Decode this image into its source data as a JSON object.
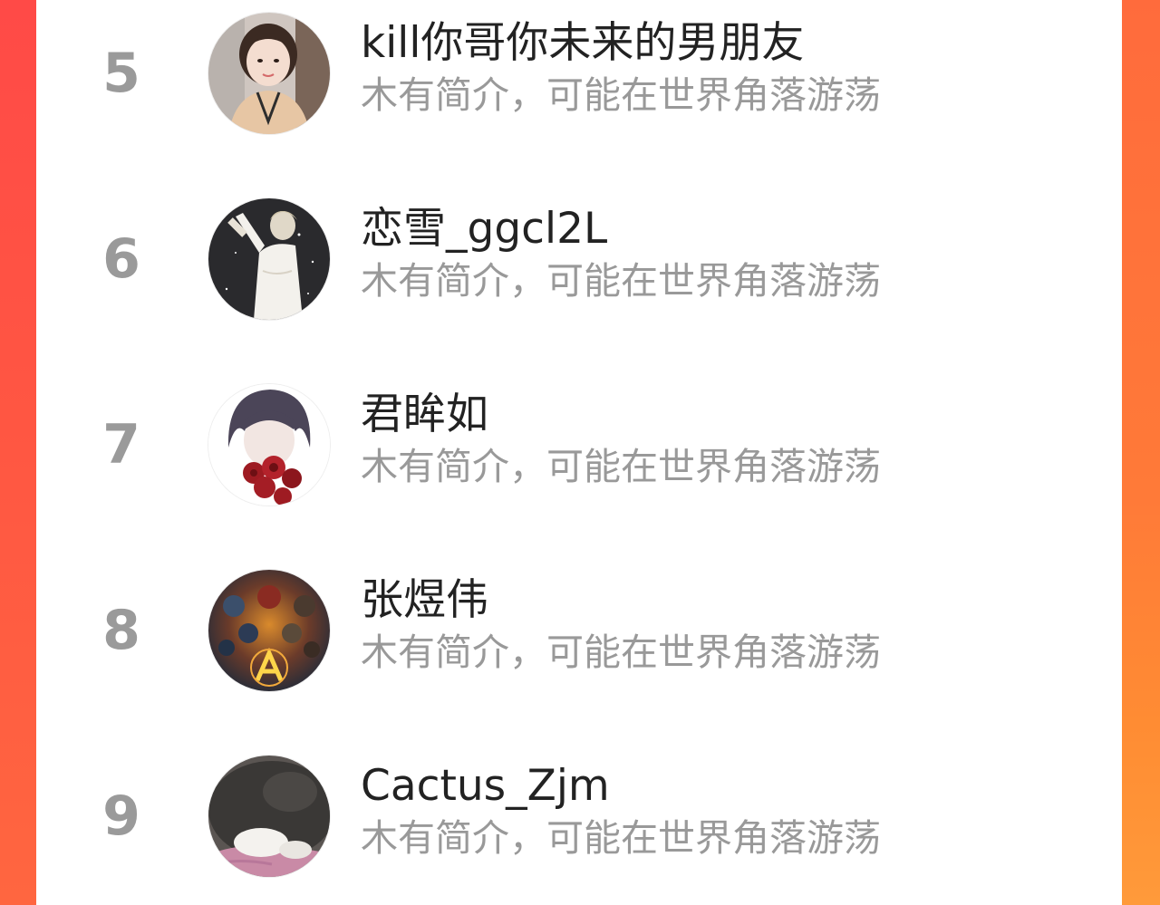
{
  "ranking": {
    "items": [
      {
        "rank": "5",
        "name": "kill你哥你未来的男朋友",
        "intro": "木有简介，可能在世界角落游荡",
        "avatar_icon": "girl-photo-avatar-icon"
      },
      {
        "rank": "6",
        "name": "恋雪_ggcl2L",
        "intro": "木有简介，可能在世界角落游荡",
        "avatar_icon": "anime-boy-avatar-icon"
      },
      {
        "rank": "7",
        "name": "君眸如",
        "intro": "木有简介，可能在世界角落游荡",
        "avatar_icon": "anime-boy-roses-avatar-icon"
      },
      {
        "rank": "8",
        "name": "张煜伟",
        "intro": "木有简介，可能在世界角落游荡",
        "avatar_icon": "avengers-poster-avatar-icon"
      },
      {
        "rank": "9",
        "name": "Cactus_Zjm",
        "intro": "木有简介，可能在世界角落游荡",
        "avatar_icon": "sleeping-cat-avatar-icon"
      }
    ]
  },
  "colors": {
    "left_bar": "#ff4a47",
    "right_bar": "#ff7a38",
    "rank_text": "#9a9a9a",
    "name_text": "#222222",
    "intro_text": "#999999"
  }
}
